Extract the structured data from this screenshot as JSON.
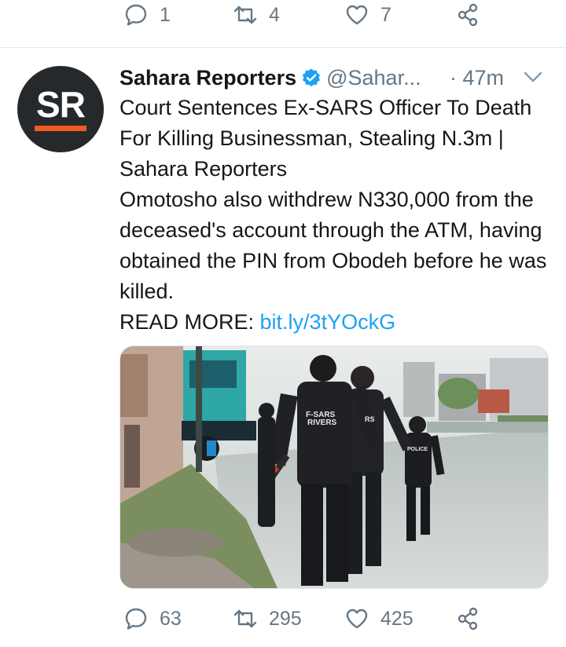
{
  "previous_tweet": {
    "reply_count": "1",
    "retweet_count": "4",
    "like_count": "7"
  },
  "tweet": {
    "author_name": "Sahara Reporters",
    "author_handle": "@Sahar...",
    "time": "· 47m",
    "avatar_text": "SR",
    "headline": "Court Sentences Ex-SARS Officer To Death For Killing Businessman, Stealing N.3m | Sahara Reporters",
    "body": "Omotosho also withdrew N330,000 from the deceased's account through the ATM, having obtained the PIN from Obodeh before he was killed.",
    "read_more_label": "READ MORE: ",
    "link_text": "bit.ly/3tYOckG",
    "media_vest_label_1": "F-SARS\nRIVERS",
    "media_vest_label_2": "RS",
    "media_vest_label_3": "POLICE",
    "reply_count": "63",
    "retweet_count": "295",
    "like_count": "425"
  },
  "icons": {
    "reply": "reply-icon",
    "retweet": "retweet-icon",
    "like": "heart-icon",
    "share": "share-icon",
    "verified": "verified-badge-icon",
    "more": "chevron-down-icon"
  },
  "colors": {
    "text": "#14171a",
    "secondary": "#657786",
    "link": "#1da1f2",
    "verified": "#1da1f2",
    "avatar_bg": "#26292c",
    "avatar_accent": "#f15a22"
  }
}
